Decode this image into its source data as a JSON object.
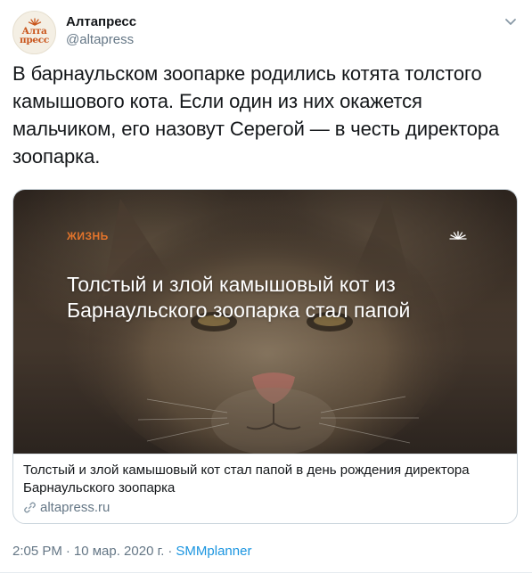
{
  "author": {
    "display_name": "Алтапресс",
    "handle": "@altapress",
    "avatar_text_line1": "Алта",
    "avatar_text_line2": "пресс"
  },
  "tweet": {
    "text": "В барнаульском зоопарке родились котята толстого камышового кота. Если один из них окажется мальчиком, его назовут Серегой — в честь директора зоопарка."
  },
  "card": {
    "image_category": "ЖИЗНЬ",
    "image_headline": "Толстый и злой камышовый кот из Барнаульского зоопарка стал папой",
    "title": "Толстый и злой камышовый кот стал папой в день рождения директора Барнаульского зоопарка",
    "domain": "altapress.ru"
  },
  "footer": {
    "time": "2:05 PM",
    "dot1": "·",
    "date": "10 мар. 2020 г.",
    "dot2": "·",
    "source": "SMMplanner"
  },
  "icons": {
    "more": "chevron-down-icon",
    "link": "link-icon",
    "brand": "sunrise-logo-icon"
  },
  "colors": {
    "accent": "#1b95e0",
    "brand_orange": "#e3742b",
    "text_secondary": "#657786"
  }
}
